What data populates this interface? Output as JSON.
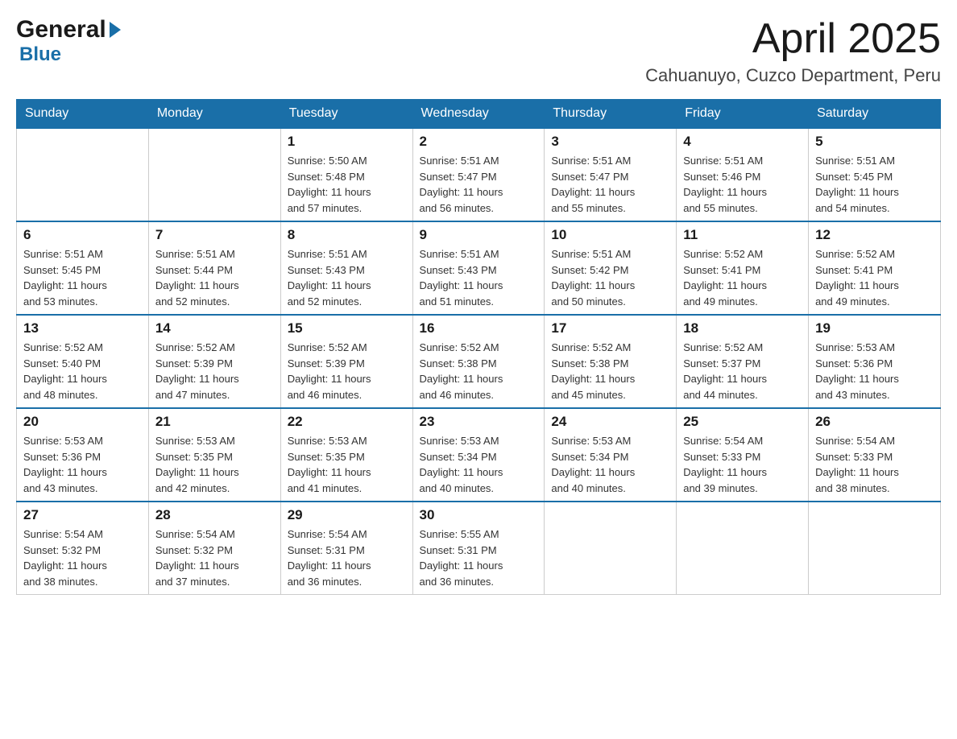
{
  "header": {
    "logo_general": "General",
    "logo_blue": "Blue",
    "month_title": "April 2025",
    "location": "Cahuanuyo, Cuzco Department, Peru"
  },
  "days_of_week": [
    "Sunday",
    "Monday",
    "Tuesday",
    "Wednesday",
    "Thursday",
    "Friday",
    "Saturday"
  ],
  "weeks": [
    [
      {
        "day": "",
        "info": ""
      },
      {
        "day": "",
        "info": ""
      },
      {
        "day": "1",
        "info": "Sunrise: 5:50 AM\nSunset: 5:48 PM\nDaylight: 11 hours\nand 57 minutes."
      },
      {
        "day": "2",
        "info": "Sunrise: 5:51 AM\nSunset: 5:47 PM\nDaylight: 11 hours\nand 56 minutes."
      },
      {
        "day": "3",
        "info": "Sunrise: 5:51 AM\nSunset: 5:47 PM\nDaylight: 11 hours\nand 55 minutes."
      },
      {
        "day": "4",
        "info": "Sunrise: 5:51 AM\nSunset: 5:46 PM\nDaylight: 11 hours\nand 55 minutes."
      },
      {
        "day": "5",
        "info": "Sunrise: 5:51 AM\nSunset: 5:45 PM\nDaylight: 11 hours\nand 54 minutes."
      }
    ],
    [
      {
        "day": "6",
        "info": "Sunrise: 5:51 AM\nSunset: 5:45 PM\nDaylight: 11 hours\nand 53 minutes."
      },
      {
        "day": "7",
        "info": "Sunrise: 5:51 AM\nSunset: 5:44 PM\nDaylight: 11 hours\nand 52 minutes."
      },
      {
        "day": "8",
        "info": "Sunrise: 5:51 AM\nSunset: 5:43 PM\nDaylight: 11 hours\nand 52 minutes."
      },
      {
        "day": "9",
        "info": "Sunrise: 5:51 AM\nSunset: 5:43 PM\nDaylight: 11 hours\nand 51 minutes."
      },
      {
        "day": "10",
        "info": "Sunrise: 5:51 AM\nSunset: 5:42 PM\nDaylight: 11 hours\nand 50 minutes."
      },
      {
        "day": "11",
        "info": "Sunrise: 5:52 AM\nSunset: 5:41 PM\nDaylight: 11 hours\nand 49 minutes."
      },
      {
        "day": "12",
        "info": "Sunrise: 5:52 AM\nSunset: 5:41 PM\nDaylight: 11 hours\nand 49 minutes."
      }
    ],
    [
      {
        "day": "13",
        "info": "Sunrise: 5:52 AM\nSunset: 5:40 PM\nDaylight: 11 hours\nand 48 minutes."
      },
      {
        "day": "14",
        "info": "Sunrise: 5:52 AM\nSunset: 5:39 PM\nDaylight: 11 hours\nand 47 minutes."
      },
      {
        "day": "15",
        "info": "Sunrise: 5:52 AM\nSunset: 5:39 PM\nDaylight: 11 hours\nand 46 minutes."
      },
      {
        "day": "16",
        "info": "Sunrise: 5:52 AM\nSunset: 5:38 PM\nDaylight: 11 hours\nand 46 minutes."
      },
      {
        "day": "17",
        "info": "Sunrise: 5:52 AM\nSunset: 5:38 PM\nDaylight: 11 hours\nand 45 minutes."
      },
      {
        "day": "18",
        "info": "Sunrise: 5:52 AM\nSunset: 5:37 PM\nDaylight: 11 hours\nand 44 minutes."
      },
      {
        "day": "19",
        "info": "Sunrise: 5:53 AM\nSunset: 5:36 PM\nDaylight: 11 hours\nand 43 minutes."
      }
    ],
    [
      {
        "day": "20",
        "info": "Sunrise: 5:53 AM\nSunset: 5:36 PM\nDaylight: 11 hours\nand 43 minutes."
      },
      {
        "day": "21",
        "info": "Sunrise: 5:53 AM\nSunset: 5:35 PM\nDaylight: 11 hours\nand 42 minutes."
      },
      {
        "day": "22",
        "info": "Sunrise: 5:53 AM\nSunset: 5:35 PM\nDaylight: 11 hours\nand 41 minutes."
      },
      {
        "day": "23",
        "info": "Sunrise: 5:53 AM\nSunset: 5:34 PM\nDaylight: 11 hours\nand 40 minutes."
      },
      {
        "day": "24",
        "info": "Sunrise: 5:53 AM\nSunset: 5:34 PM\nDaylight: 11 hours\nand 40 minutes."
      },
      {
        "day": "25",
        "info": "Sunrise: 5:54 AM\nSunset: 5:33 PM\nDaylight: 11 hours\nand 39 minutes."
      },
      {
        "day": "26",
        "info": "Sunrise: 5:54 AM\nSunset: 5:33 PM\nDaylight: 11 hours\nand 38 minutes."
      }
    ],
    [
      {
        "day": "27",
        "info": "Sunrise: 5:54 AM\nSunset: 5:32 PM\nDaylight: 11 hours\nand 38 minutes."
      },
      {
        "day": "28",
        "info": "Sunrise: 5:54 AM\nSunset: 5:32 PM\nDaylight: 11 hours\nand 37 minutes."
      },
      {
        "day": "29",
        "info": "Sunrise: 5:54 AM\nSunset: 5:31 PM\nDaylight: 11 hours\nand 36 minutes."
      },
      {
        "day": "30",
        "info": "Sunrise: 5:55 AM\nSunset: 5:31 PM\nDaylight: 11 hours\nand 36 minutes."
      },
      {
        "day": "",
        "info": ""
      },
      {
        "day": "",
        "info": ""
      },
      {
        "day": "",
        "info": ""
      }
    ]
  ]
}
